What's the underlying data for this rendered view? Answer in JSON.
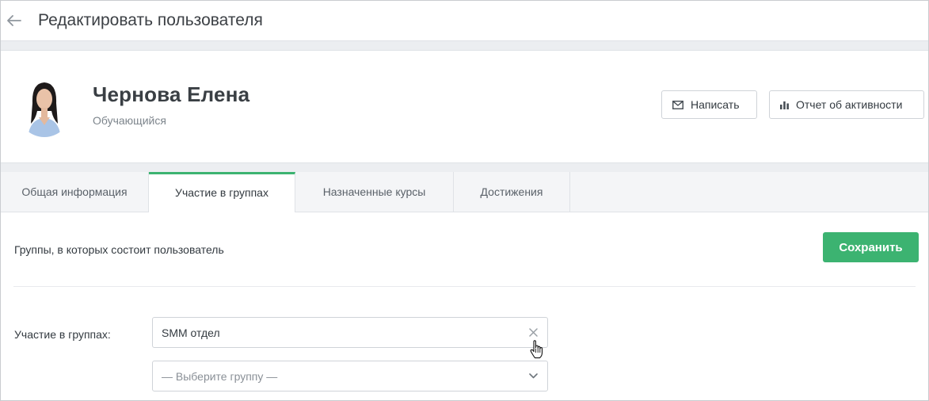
{
  "header": {
    "title": "Редактировать пользователя"
  },
  "profile": {
    "name": "Чернова Елена",
    "role": "Обучающийся",
    "actions": [
      {
        "label": "Написать",
        "icon": "mail-icon"
      },
      {
        "label": "Отчет об активности",
        "icon": "bar-chart-icon"
      }
    ]
  },
  "tabs": [
    {
      "label": "Общая информация",
      "active": false
    },
    {
      "label": "Участие в группах",
      "active": true
    },
    {
      "label": "Назначенные курсы",
      "active": false
    },
    {
      "label": "Достижения",
      "active": false
    }
  ],
  "groups": {
    "description": "Группы, в которых состоит пользователь",
    "save_label": "Сохранить",
    "field_label": "Участие в группах:",
    "selected_group": "SMM отдел",
    "select_placeholder": "— Выберите группу —"
  },
  "colors": {
    "accent": "#3cb371",
    "band": "#eceef1",
    "border": "#cfd3d8"
  }
}
